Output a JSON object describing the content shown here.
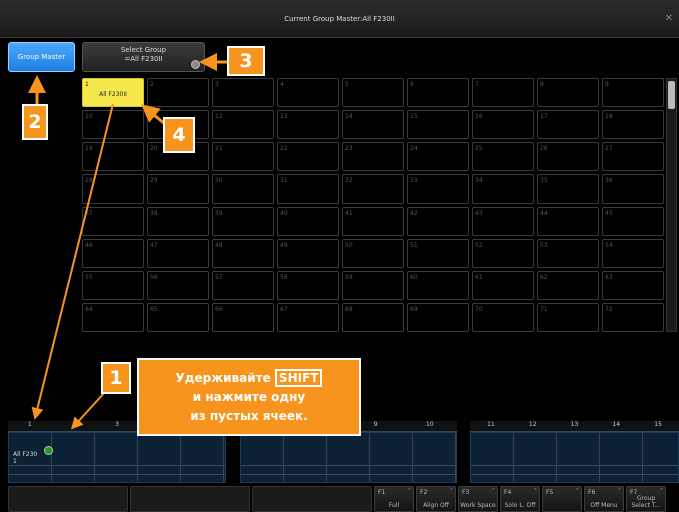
{
  "window": {
    "title": "Current Group Master:All F230II",
    "close_glyph": "✕"
  },
  "toolbar": {
    "group_master_label": "Group Master",
    "select_group_line1": "Select Group",
    "select_group_line2": "=All F230II"
  },
  "grid": {
    "cells": [
      {
        "num": "1",
        "label": "All F230II",
        "active": true
      },
      {
        "num": "2"
      },
      {
        "num": "3"
      },
      {
        "num": "4"
      },
      {
        "num": "5"
      },
      {
        "num": "6"
      },
      {
        "num": "7"
      },
      {
        "num": "8"
      },
      {
        "num": "9"
      },
      {
        "num": "10"
      },
      {
        "num": "11"
      },
      {
        "num": "12"
      },
      {
        "num": "13"
      },
      {
        "num": "14"
      },
      {
        "num": "15"
      },
      {
        "num": "16"
      },
      {
        "num": "17"
      },
      {
        "num": "18"
      },
      {
        "num": "19"
      },
      {
        "num": "20"
      },
      {
        "num": "21"
      },
      {
        "num": "22"
      },
      {
        "num": "23"
      },
      {
        "num": "24"
      },
      {
        "num": "25"
      },
      {
        "num": "26"
      },
      {
        "num": "27"
      },
      {
        "num": "28"
      },
      {
        "num": "29"
      },
      {
        "num": "30"
      },
      {
        "num": "31"
      },
      {
        "num": "32"
      },
      {
        "num": "33"
      },
      {
        "num": "34"
      },
      {
        "num": "35"
      },
      {
        "num": "36"
      },
      {
        "num": "37"
      },
      {
        "num": "38"
      },
      {
        "num": "39"
      },
      {
        "num": "40"
      },
      {
        "num": "41"
      },
      {
        "num": "42"
      },
      {
        "num": "43"
      },
      {
        "num": "44"
      },
      {
        "num": "45"
      },
      {
        "num": "46"
      },
      {
        "num": "47"
      },
      {
        "num": "48"
      },
      {
        "num": "49"
      },
      {
        "num": "50"
      },
      {
        "num": "51"
      },
      {
        "num": "52"
      },
      {
        "num": "53"
      },
      {
        "num": "54"
      },
      {
        "num": "55"
      },
      {
        "num": "56"
      },
      {
        "num": "57"
      },
      {
        "num": "58"
      },
      {
        "num": "59"
      },
      {
        "num": "60"
      },
      {
        "num": "61"
      },
      {
        "num": "62"
      },
      {
        "num": "63"
      },
      {
        "num": "64"
      },
      {
        "num": "65"
      },
      {
        "num": "66"
      },
      {
        "num": "67"
      },
      {
        "num": "68"
      },
      {
        "num": "69"
      },
      {
        "num": "70"
      },
      {
        "num": "71"
      },
      {
        "num": "72"
      }
    ]
  },
  "executors": {
    "left_numbers": [
      "1",
      "",
      "3",
      "",
      ""
    ],
    "mid_numbers": [
      "",
      "",
      "9",
      "10"
    ],
    "right_numbers": [
      "11",
      "12",
      "13",
      "14",
      "15"
    ],
    "first_label": "All F230",
    "first_sub": "1"
  },
  "fkeys": [
    {
      "key": "F1",
      "label": "Full"
    },
    {
      "key": "F2",
      "label": "Align Off"
    },
    {
      "key": "F3",
      "label": "Work Space"
    },
    {
      "key": "F4",
      "label": "Solo L. Off"
    },
    {
      "key": "F5",
      "label": ""
    },
    {
      "key": "F6",
      "label": "Off Menu"
    },
    {
      "key": "F7",
      "label": "Group Select T..."
    }
  ],
  "callouts": {
    "n1": "1",
    "n2": "2",
    "n3": "3",
    "n4": "4",
    "note_line1_a": "Удерживайте",
    "note_shift": "SHIFT",
    "note_line2": "и нажмите одну",
    "note_line3": "из пустых ячеек."
  },
  "colors": {
    "accent_orange": "#f6941e",
    "group_selected": "#f6e84c",
    "group_master_blue": "#1f7fe0"
  }
}
